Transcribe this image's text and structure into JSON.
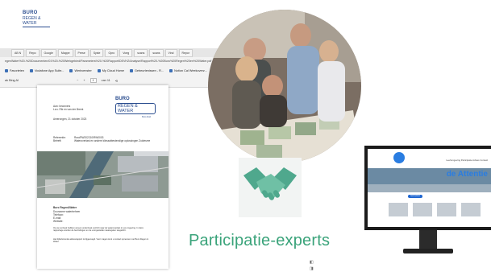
{
  "logo": {
    "line1": "BURO",
    "line2": "REGEN & WATER"
  },
  "browser": {
    "tabs": [
      "AB N",
      "Repo",
      "Google",
      "Mappe",
      "Prese",
      "Syste",
      "Opro",
      "Voeg",
      "scans",
      "scans",
      "Vind",
      "Repor"
    ],
    "url": "egenWater%20-%20Documenten/01%20-%20Werkgebied/Parameters%20-%20Rapport/DEVHZ/Analyse/Rapport%20-%20Buro%20Regen%20en%20Water.pdf",
    "favorites": [
      "Favorieten",
      "Vodafone App Suite...",
      "Werkvenster",
      "My Cloud Home",
      "Gebeurtenissen - R...",
      "",
      "Notion Cal Weekoverz...",
      "",
      "Welkom bij Mijnorg..."
    ],
    "pdf_label": "ak Bing AI",
    "page_current": "1",
    "page_of": "van 11"
  },
  "document": {
    "logo_line1": "BURO",
    "logo_line2": "REGEN & WATER",
    "logo_line3": "Buro Zuid",
    "addressee": [
      "Aan: bewoners",
      "t.a.v. Rik en van der Breek"
    ],
    "date": "Amerongen, 21 oktober 2023",
    "ref_label": "Referentie:",
    "ref_value": "Rwo/RW202210/RW0003",
    "subject_label": "Betreft:",
    "subject_value": "Wateroverlast en andere klimaatbestendige oplossingen Zuiderzee",
    "contact_title": "Buro Regen&Water",
    "contact_lines": [
      "Duurzame waterbeheer",
      "Telefoon:",
      "E-mail:",
      "Website:"
    ],
    "body_text": "Op uw verzoek hebben wij een onderzoek verricht naar de wateroverlast in uw omgeving. In deze rapportage worden de bevindingen en de voorgestelde maatregelen toegelicht.",
    "body_text2": "Het bijbehorende adviesrapport is bijgevoegd. Voor vragen kunt u contact opnemen met Buro Regen & Water."
  },
  "card": {
    "label": "Participatie-experts"
  },
  "website": {
    "hero_text": "de Attentie",
    "nav": "Leefomgeving  Participatie  Advies  Contact",
    "button": "Aanmelden"
  },
  "colors": {
    "brand_blue": "#2a4d8f",
    "card_green": "#3aa37a",
    "handshake_green": "#4fa88d"
  }
}
